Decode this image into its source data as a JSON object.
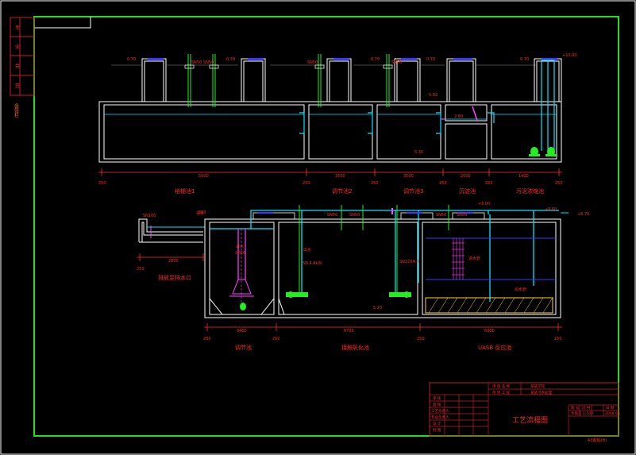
{
  "colors": {
    "background": "#000000",
    "frame": "#22dd22",
    "structure": "#ffffff",
    "pipe": "#00e5ff",
    "dimension": "#ff2a2a",
    "label": "#ff2a2a",
    "equipment": "#22ee22",
    "accent": "#ff44ff",
    "water": "#3a3aff",
    "filter_media": "#ffd040",
    "title_block": "#c0202a"
  },
  "side_strip": {
    "cells": [
      "专",
      "业",
      "会",
      "签"
    ],
    "bottom_label": "会签栏"
  },
  "top_section": {
    "levels": [
      "0.70",
      "0.70",
      "0.70",
      "0.70",
      "0.70",
      "+10.00"
    ],
    "inner_levels": [
      "5.92",
      "2.60",
      "5.35"
    ],
    "valve_labels": [
      "SN50",
      "SN50",
      "SN50",
      "SN50"
    ],
    "dims": [
      "5500",
      "3500",
      "3500",
      "2000",
      "1400"
    ],
    "small_dims": [
      "250",
      "250",
      "250",
      "250",
      "250",
      "250"
    ],
    "tank_labels": [
      "格栅池1",
      "调节池2",
      "调节池3",
      "沉淀池",
      "污泥浓缩池"
    ]
  },
  "bottom_section": {
    "levels": [
      "+6.00",
      "+6.60",
      "+6.70",
      "5.20"
    ],
    "left_inlet": {
      "level": "SN100",
      "pipe_label": "进水",
      "dim": "2800",
      "small": "250",
      "note": "排放至排水口"
    },
    "valve_labels": [
      "SN50",
      "SN50",
      "SN50",
      "SN50"
    ],
    "annotations": [
      "进水",
      "3PK4",
      "出水",
      "SN 4.4kW",
      "SN32X4.4",
      "进水管",
      "出水管"
    ],
    "dims": [
      "3400",
      "6700",
      "6300"
    ],
    "small_dims": [
      "200",
      "250",
      "250",
      "250"
    ],
    "tank_labels": [
      "调节池",
      "接触氧化池",
      "UASB 反应池"
    ]
  },
  "title_block": {
    "project_rows": [
      "项 目 名 称",
      "单 项 工 程"
    ],
    "project_values": [
      "某某学院",
      "某某污水处理"
    ],
    "left_rows": [
      "审 核",
      "复 核",
      "工艺负责人",
      "专业负责人",
      "设 计",
      "制 图"
    ],
    "drawing_title": "工艺流程图",
    "right_rows": [
      "图 号",
      "比 例",
      "日 期"
    ],
    "right_values": [
      "水施-1",
      "1:100",
      "2008.06"
    ],
    "footer": "A3图幅(H)"
  }
}
